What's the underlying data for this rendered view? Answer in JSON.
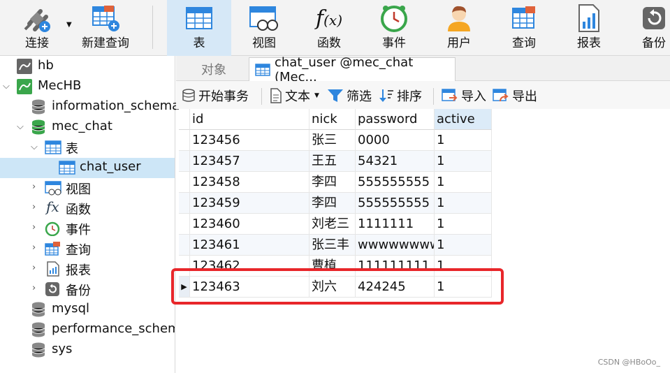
{
  "toolbar": {
    "connect": "连接",
    "new_query": "新建查询",
    "table": "表",
    "view": "视图",
    "function": "函数",
    "event": "事件",
    "user": "用户",
    "query": "查询",
    "report": "报表",
    "backup": "备份"
  },
  "sidebar": {
    "items": [
      {
        "label": "hb"
      },
      {
        "label": "MecHB"
      },
      {
        "label": "information_schema"
      },
      {
        "label": "mec_chat"
      },
      {
        "label": "表"
      },
      {
        "label": "chat_user"
      },
      {
        "label": "视图"
      },
      {
        "label": "函数"
      },
      {
        "label": "事件"
      },
      {
        "label": "查询"
      },
      {
        "label": "报表"
      },
      {
        "label": "备份"
      },
      {
        "label": "mysql"
      },
      {
        "label": "performance_schema"
      },
      {
        "label": "sys"
      }
    ]
  },
  "tabs": {
    "objects": "对象",
    "active_tab": "chat_user @mec_chat (Mec..."
  },
  "subtoolbar": {
    "begin_txn": "开始事务",
    "text": "文本",
    "filter": "筛选",
    "sort": "排序",
    "import": "导入",
    "export": "导出"
  },
  "grid": {
    "columns": [
      "id",
      "nick",
      "password",
      "active"
    ],
    "rows": [
      [
        "123456",
        "张三",
        "0000",
        "1"
      ],
      [
        "123457",
        "王五",
        "54321",
        "1"
      ],
      [
        "123458",
        "李四",
        "555555555",
        "1"
      ],
      [
        "123459",
        "李四",
        "555555555",
        "1"
      ],
      [
        "123460",
        "刘老三",
        "1111111",
        "1"
      ],
      [
        "123461",
        "张三丰",
        "wwwwwwww",
        "1"
      ],
      [
        "123462",
        "曹植",
        "111111111",
        "1"
      ],
      [
        "123463",
        "刘六",
        "424245",
        "1"
      ]
    ]
  },
  "watermark": "CSDN @HBoOo_",
  "colors": {
    "accent": "#2e86de",
    "highlight": "#e8262a",
    "selected": "#cde6f7"
  }
}
